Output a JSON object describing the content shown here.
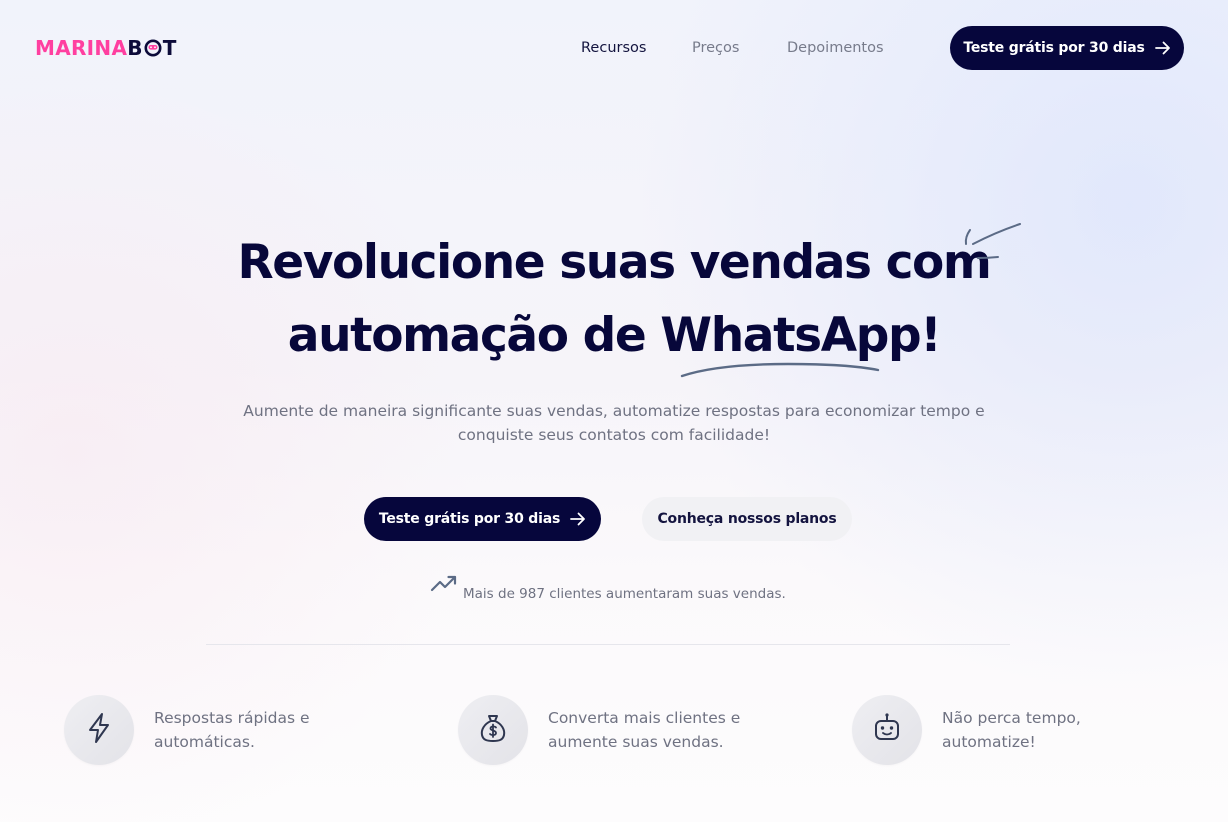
{
  "brand": {
    "logo_part1": "MARINA",
    "logo_part2_b": "B",
    "logo_part2_t": "T",
    "logo_icon": "robot-o-icon",
    "pink": "#ff3fa0",
    "navy": "#06063c"
  },
  "nav": {
    "items": [
      {
        "label": "Recursos",
        "active": true
      },
      {
        "label": "Preços",
        "active": false
      },
      {
        "label": "Depoimentos",
        "active": false
      }
    ],
    "cta_label": "Teste grátis por 30 dias",
    "cta_icon": "arrow-right-icon"
  },
  "hero": {
    "title_line1": "Revolucione suas vendas com",
    "title_line2": "automação de WhatsApp!",
    "subtitle_line1": "Aumente de maneira significante suas vendas, automatize respostas para economizar tempo e",
    "subtitle_line2": "conquiste seus contatos com facilidade!",
    "primary_cta": "Teste grátis por 30 dias",
    "secondary_cta": "Conheça nossos planos",
    "social_proof_icon": "trending-up-icon",
    "social_proof": "Mais de 987 clientes aumentaram suas vendas."
  },
  "features": [
    {
      "icon": "lightning-icon",
      "line1": "Respostas rápidas e",
      "line2": "automáticas."
    },
    {
      "icon": "money-bag-icon",
      "line1": "Converta mais clientes e",
      "line2": "aumente suas vendas."
    },
    {
      "icon": "robot-icon",
      "line1": "Não perca tempo,",
      "line2": "automatize!"
    }
  ]
}
